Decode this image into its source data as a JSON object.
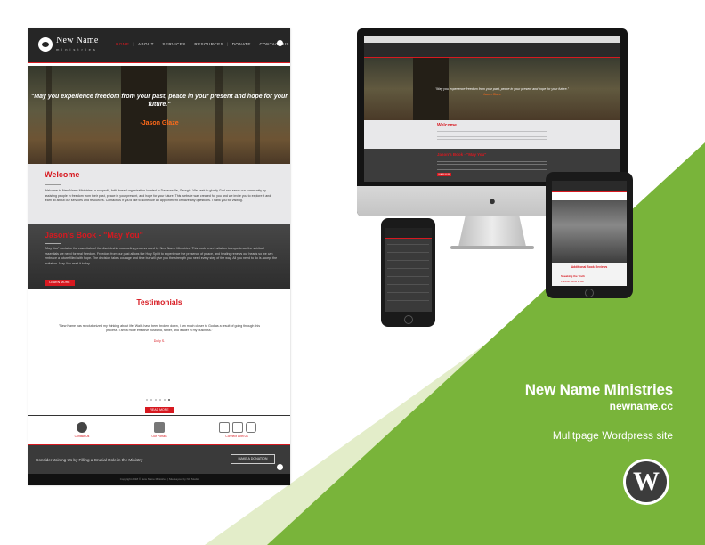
{
  "colors": {
    "green": "#79b43a",
    "light_green": "#e3edc9",
    "brand_red": "#d71920"
  },
  "site": {
    "brand": "New Name",
    "brand_sub": "ministries",
    "nav": [
      "HOME",
      "ABOUT",
      "SERVICES",
      "RESOURCES",
      "DONATE",
      "CONTACT US"
    ],
    "hero_quote": "\"May you experience freedom from your past, peace in your present and hope for your future.\"",
    "hero_author": "-Jason Glaze",
    "welcome_title": "Welcome",
    "welcome_body": "Welcome to New Name Ministries, a nonprofit, faith-based organization located in Dawsonville, Georgia. We seek to glorify God and serve our community by assisting people in freedom from their past, peace in your present, and hope for your future. This website was created for you and we invite you to explore it and learn all about our services and resources. Contact us if you'd like to schedule an appointment or have any questions. Thank you for visiting.",
    "book_title": "Jason's Book - \"May You\"",
    "book_body": "\"May You\" contains the essentials of the discipleship counseling process used by New Name Ministries. This book is an invitation to experience the spiritual essentials we need for real freedom. Freedom from our past allows the Holy Spirit to experience the presence of peace, and healing renews our hearts so we can embrace a future filled with hope. The decision takes courage and time but will give you the strength you need every step of the way. All you need to do is accept the invitation. May You read it today.",
    "book_button": "LEARN MORE",
    "testimonials_title": "Testimonials",
    "testimonial_text": "\"New Name has revolutionized my thinking about life. Walls have been broken down, I am much closer to God as a result of going through this process. I am a more effective husband, father, and leader in my business.\"",
    "testimonial_author": "Dolly S.",
    "review_button": "READ MORE",
    "icon_labels": [
      "Contact Us",
      "Our Portals",
      "Connect With Us"
    ],
    "footer_text": "Consider Joining Us by Filling a Crucial Role in the Ministry",
    "donate_button": "MAKE A DONATION",
    "copyright": "Copyright 2018 © New Name Ministries | Site Layout by NC Studio"
  },
  "devices": {
    "imac": {
      "quote": "\"May you experience freedom from your past, peace in your present and hope for your future.\"",
      "author": "Jason Glaze",
      "welcome": "Welcome",
      "book": "Jason's Book - \"May You\"",
      "button": "LEARN MORE"
    },
    "ipad": {
      "section": "Additional Book Reviews",
      "item": "Speaking the Truth",
      "item2": "Forever: How to Be"
    }
  },
  "project": {
    "title": "New Name Ministries",
    "domain": "newname.cc",
    "subtitle": "Mulitpage Wordpress site",
    "platform_icon": "wordpress-icon"
  }
}
